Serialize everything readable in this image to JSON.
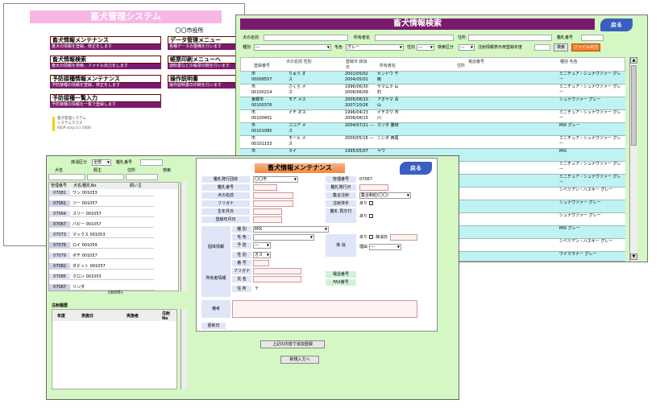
{
  "menu_window": {
    "title": "畜犬管理システム",
    "city": "〇〇市役所",
    "items": [
      {
        "label": "畜犬情報メンテナンス",
        "desc": "畜犬の情報を登録、修正をします"
      },
      {
        "label": "畜犬情報検索",
        "desc": "畜犬の情報を検索、ファイル出力をします"
      },
      {
        "label": "予防接種情報メンテナンス",
        "desc": "予防接種の情報を登録、修正をします"
      },
      {
        "label": "予防接種一覧入力",
        "desc": "予防接種の情報を一覧で登録します"
      },
      {
        "label": "データ管理メニュー",
        "desc": "各種データの整備を行います"
      },
      {
        "label": "帳票印刷メニューへ",
        "desc": "通知書などの帳票印刷を行います"
      },
      {
        "label": "操作説明書",
        "desc": "操作説明書の印刷を行います"
      }
    ],
    "footer": [
      "畜犬管理システム",
      "システムマスタ",
      "ISGP corp.(c) 1000"
    ]
  },
  "search_window": {
    "title": "畜犬情報検索",
    "back": "戻る",
    "filters": {
      "dog_name": "犬の名前",
      "owner_name": "所有者名",
      "address": "住所",
      "kanri_no": "鑑札番号",
      "kind": "種別",
      "kind_val": "---",
      "color": "毛色",
      "color_val": "グレー",
      "sex": "性別",
      "sex_val": "---",
      "district": "地区",
      "district_val": "---",
      "area": "検索区分",
      "inj": "注射情報表示用登録年度",
      "search_btn": "検索",
      "export_btn": "ファイル出力"
    },
    "headers": [
      "登録番号",
      "犬の名前 性別",
      "登録日 抹消日",
      "所有者名",
      "住所",
      "電話番号",
      "種別 毛色"
    ],
    "rows": [
      {
        "reg": "市 00008557",
        "name": "りゅう オス",
        "date": "2001/05/02 2004/05/01",
        "owner": "センドウ 千暁",
        "kind": "ミニチュア・シュナウツァー グレー"
      },
      {
        "reg": "市 00100214",
        "name": "さくら メス",
        "date": "1996/06/30 2006/06/09",
        "owner": "ヤマムラ 山村",
        "kind": "ミニチュア・シュナウツァー グレー"
      },
      {
        "reg": "東郷市 00100376",
        "name": "モア メス",
        "date": "2005/08/10 2007/10/26",
        "owner": "アオヤマ 青山",
        "kind": "シュナウツァー グレー"
      },
      {
        "reg": "市 00100401",
        "name": "イチ オス",
        "date": "1996/04/23 2006/08/15",
        "owner": "イチカワ 市川",
        "kind": "ミニチュア・シュナウツァー グレー"
      },
      {
        "reg": "市 00101085",
        "name": "ココア メス",
        "date": "2004/07/21 ---",
        "owner": "カツダ 勝田",
        "kind": "MIX グレー"
      },
      {
        "reg": "市 00101153",
        "name": "モール メス",
        "date": "2000/05/16 ---",
        "owner": "ニシダ 西尾",
        "kind": "ミニチュア・シュナウツァー グレー"
      },
      {
        "reg": "市",
        "name": "ライ",
        "date": "1995/05/07",
        "owner": "ヤワ",
        "kind": "MIX"
      }
    ],
    "right_col": [
      "ミニチュア・シュナウツァー グレー",
      "ミニチュア・シュナウツァー グレー",
      "シベリアン・ハスキー グレー",
      "シュナウツァー グレー",
      "シュナウツァー グレー",
      "MIX グレー",
      "シベリアン・ハスキー グレー",
      "ワイマラナー グレー",
      "シベリアン・ハスキー グレー"
    ]
  },
  "maint_window": {
    "title": "畜犬情報メンテナンス",
    "back": "戻る",
    "left": {
      "reg_kind": "抹消区分",
      "reg_kind_val": "全部",
      "kanri": "鑑札番号",
      "dog_name": "犬名",
      "owner_col": "飼主",
      "address": "住所",
      "search": "検索",
      "col1": "管理番号",
      "col2": "犬名/鑑札No",
      "col3": "飼い主",
      "list": [
        {
          "id": "07081",
          "name": "ワン 001053"
        },
        {
          "id": "07061",
          "name": "ツー 001057"
        },
        {
          "id": "07064",
          "name": "スリー 001057"
        },
        {
          "id": "07067",
          "name": "パピー 001057"
        },
        {
          "id": "07073",
          "name": "マックス 001053"
        },
        {
          "id": "07076",
          "name": "ロイ 001059"
        },
        {
          "id": "07079",
          "name": "ポチ 001057"
        },
        {
          "id": "07082",
          "name": "ダビット 001057"
        },
        {
          "id": "07085",
          "name": "クロン 001053"
        },
        {
          "id": "07087",
          "name": "リンダ"
        }
      ],
      "count": "(000件)",
      "history_title": "注射履歴",
      "h_col1": "年度",
      "h_col2": "実施日",
      "h_col3": "実施者",
      "h_col4": "注射 No"
    },
    "form": {
      "issuer": "鑑札発行団体",
      "issuer_val": "〇〇市",
      "kanri_label": "管理番号",
      "kanri_val": "07067",
      "kansatsu": "鑑札番号",
      "kansatsu_date": "鑑札発行日",
      "dog_name": "犬の名前",
      "furigana": "フリガナ",
      "birth": "生年月日",
      "reg_date": "登録年月日",
      "group": "集合注射",
      "group_val": "集合和紅(〇〇)",
      "inj_done": "注射済手",
      "inj_done_val": "あり",
      "reissue": "鑑札 再交付",
      "reissue_val": "あり",
      "indiv": "個体情報",
      "kind": "種 別",
      "kind_val": "MIX",
      "color": "毛 色",
      "prevent": "予 防",
      "prevent_val": "---",
      "sex": "性 別",
      "sex_val": "オス",
      "delete": "抹 消",
      "delete_val": "あり",
      "delete_date": "抹消日",
      "reason": "理由",
      "reason_val": "---",
      "owner": "所有者情報",
      "no": "番 号",
      "furigana2": "フリガナ",
      "owner_name": "氏 名",
      "addr": "住 所",
      "addr_val": "〒",
      "tel": "電話番号",
      "fax": "FAX番号",
      "remarks": "備考",
      "updated": "更新日",
      "save_btn": "上記の内容で追加登録",
      "new_btn": "新規入力へ"
    }
  }
}
